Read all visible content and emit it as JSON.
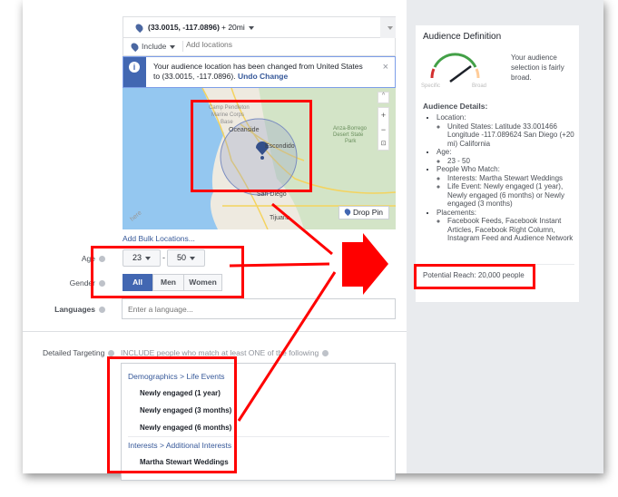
{
  "location": {
    "selected": "(33.0015, -117.0896)",
    "radius": "+ 20mi",
    "include_label": "Include",
    "add_placeholder": "Add locations"
  },
  "notice": {
    "text": "Your audience location has been changed from United States to (33.0015, -117.0896).",
    "undo": "Undo Change"
  },
  "map": {
    "labels": [
      "Camp Pendleton",
      "Marine Corps",
      "Base",
      "Oceanside",
      "Escondido",
      "Anza-Borrego",
      "Desert State",
      "Park",
      "San Diego",
      "Tijuana",
      "here"
    ],
    "drop_pin": "Drop Pin"
  },
  "add_bulk": "Add Bulk Locations...",
  "age": {
    "label": "Age",
    "min": "23",
    "max": "50",
    "sep": "-"
  },
  "gender": {
    "label": "Gender",
    "options": [
      "All",
      "Men",
      "Women"
    ],
    "selected": "All"
  },
  "languages": {
    "label": "Languages",
    "placeholder": "Enter a language..."
  },
  "detailed": {
    "label": "Detailed Targeting",
    "intro": "INCLUDE people who match at least ONE of the following",
    "groups": [
      {
        "path": "Demographics",
        "sub": "Life Events",
        "items": [
          "Newly engaged (1 year)",
          "Newly engaged (3 months)",
          "Newly engaged (6 months)"
        ]
      },
      {
        "path": "Interests",
        "sub": "Additional Interests",
        "items": [
          "Martha Stewart Weddings"
        ]
      }
    ]
  },
  "audience": {
    "title": "Audience Definition",
    "gauge_specific": "Specific",
    "gauge_broad": "Broad",
    "summary": "Your audience selection is fairly broad.",
    "details_title": "Audience Details:",
    "details": [
      {
        "h": "Location:",
        "v": [
          "United States: Latitude 33.001466 Longitude -117.089624 San Diego (+20 mi) California"
        ]
      },
      {
        "h": "Age:",
        "v": [
          "23 - 50"
        ]
      },
      {
        "h": "People Who Match:",
        "v": [
          "Interests: Martha Stewart Weddings",
          "Life Event: Newly engaged (1 year), Newly engaged (6 months) or Newly engaged (3 months)"
        ]
      },
      {
        "h": "Placements:",
        "v": [
          "Facebook Feeds, Facebook Instant Articles, Facebook Right Column, Instagram Feed and Audience Network"
        ]
      }
    ],
    "reach": "Potential Reach: 20,000 people"
  },
  "colors": {
    "accent": "#4267b2",
    "annotation": "#ff0000",
    "link": "#365899"
  }
}
